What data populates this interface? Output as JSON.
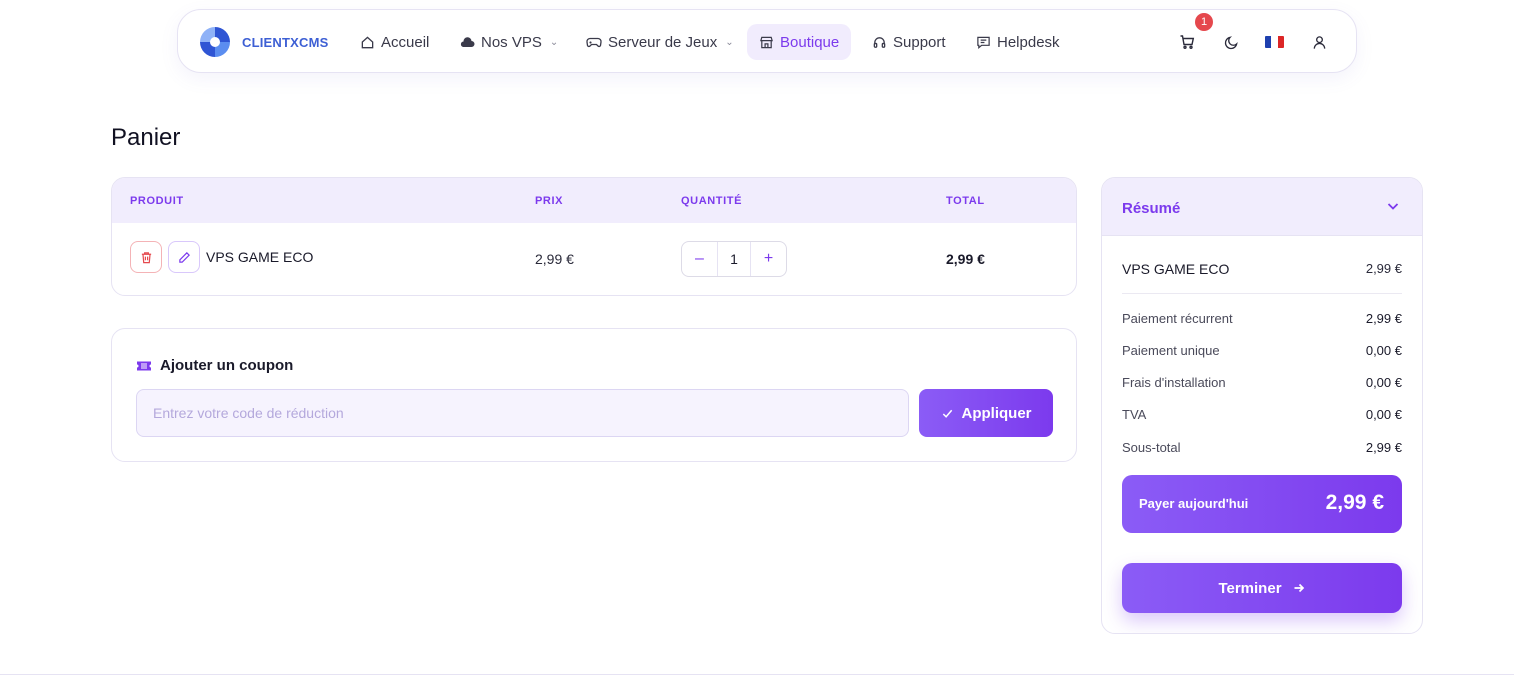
{
  "brand": {
    "name": "CLIENTXCMS",
    "accent": "#7c3aed",
    "logo_color": "#3d5fd4"
  },
  "nav": {
    "items": [
      {
        "label": "Accueil",
        "icon": "home-icon"
      },
      {
        "label": "Nos VPS",
        "icon": "cloud-icon",
        "dropdown": true
      },
      {
        "label": "Serveur de Jeux",
        "icon": "gamepad-icon",
        "dropdown": true
      },
      {
        "label": "Boutique",
        "icon": "store-icon",
        "active": true
      },
      {
        "label": "Support",
        "icon": "headset-icon"
      },
      {
        "label": "Helpdesk",
        "icon": "message-icon"
      }
    ],
    "cart_count": "1",
    "language": "FR"
  },
  "page_title": "Panier",
  "cart": {
    "headers": {
      "product": "PRODUIT",
      "price": "PRIX",
      "quantity": "QUANTITÉ",
      "total": "TOTAL"
    },
    "rows": [
      {
        "product": "VPS GAME ECO",
        "price": "2,99 €",
        "quantity": "1",
        "total": "2,99 €"
      }
    ],
    "qty_minus": "–",
    "qty_plus": "+"
  },
  "coupon": {
    "title": "Ajouter un coupon",
    "placeholder": "Entrez votre code de réduction",
    "button": "Appliquer"
  },
  "summary": {
    "title": "Résumé",
    "product": {
      "name": "VPS GAME ECO",
      "price": "2,99 €"
    },
    "lines": [
      {
        "label": "Paiement récurrent",
        "value": "2,99 €"
      },
      {
        "label": "Paiement unique",
        "value": "0,00 €"
      },
      {
        "label": "Frais d'installation",
        "value": "0,00 €"
      },
      {
        "label": "TVA",
        "value": "0,00 €"
      },
      {
        "label": "Sous-total",
        "value": "2,99 €"
      }
    ],
    "pay_today_label": "Payer aujourd'hui",
    "pay_today_amount": "2,99 €",
    "finish_button": "Terminer"
  }
}
